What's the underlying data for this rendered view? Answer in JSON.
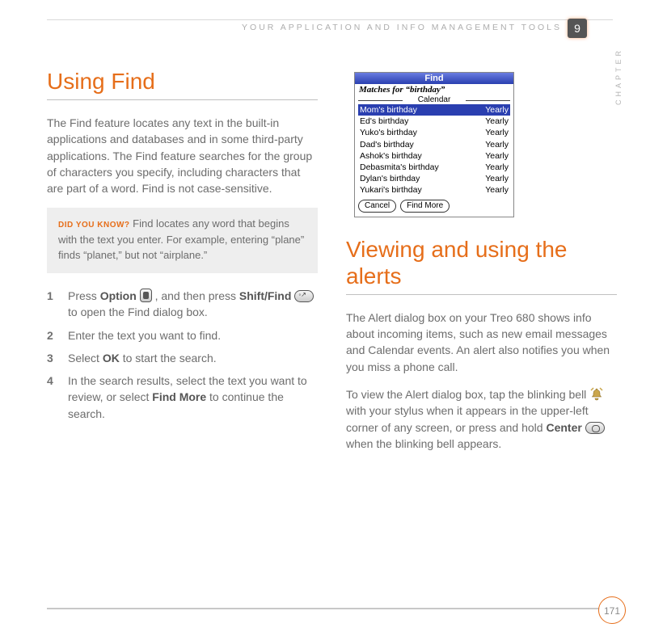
{
  "header": {
    "running_head": "YOUR APPLICATION AND INFO MANAGEMENT TOOLS",
    "chapter_number": "9",
    "chapter_label": "CHAPTER"
  },
  "left_column": {
    "heading": "Using Find",
    "intro": "The Find feature locates any text in the built-in applications and databases and in some third-party applications. The Find feature searches for the group of characters you specify, including characters that are part of a word. Find is not case-sensitive.",
    "tip_label": "DID YOU KNOW?",
    "tip_text": " Find locates any word that begins with the text you enter. For example, entering “plane” finds “planet,” but not “airplane.”",
    "steps": {
      "s1a": "Press ",
      "s1b_option": "Option",
      "s1c": " , and then press ",
      "s1d_shiftfind": "Shift/Find",
      "s1e": " to open the Find dialog box.",
      "s2": "Enter the text you want to find.",
      "s3a": "Select ",
      "s3b_ok": "OK",
      "s3c": " to start the search.",
      "s4a": "In the search results, select the text you want to review, or select ",
      "s4b_findmore": "Find More",
      "s4c": " to continue the search."
    }
  },
  "find_dialog": {
    "title": "Find",
    "matches_label": "Matches for “birthday”",
    "category": "Calendar",
    "rows": [
      {
        "left": "Mom's birthday",
        "right": "Yearly",
        "selected": true
      },
      {
        "left": "Ed's birthday",
        "right": "Yearly",
        "selected": false
      },
      {
        "left": "Yuko's birthday",
        "right": "Yearly",
        "selected": false
      },
      {
        "left": "Dad's birthday",
        "right": "Yearly",
        "selected": false
      },
      {
        "left": "Ashok's birthday",
        "right": "Yearly",
        "selected": false
      },
      {
        "left": "Debasmita's birthday",
        "right": "Yearly",
        "selected": false
      },
      {
        "left": "Dylan's birthday",
        "right": "Yearly",
        "selected": false
      },
      {
        "left": "Yukari's birthday",
        "right": "Yearly",
        "selected": false
      }
    ],
    "btn_cancel": "Cancel",
    "btn_more": "Find More"
  },
  "right_column": {
    "heading": "Viewing and using the alerts",
    "p1": "The Alert dialog box on your Treo 680 shows info about incoming items, such as new email messages and Calendar events. An alert also notifies you when you miss a phone call.",
    "p2a": "To view the Alert dialog box, tap the blinking bell ",
    "p2b": " with your stylus when it appears in the upper-left corner of any screen, or press and hold ",
    "p2c_center": "Center",
    "p2d": " when the blinking bell appears."
  },
  "footer": {
    "page_number": "171"
  }
}
